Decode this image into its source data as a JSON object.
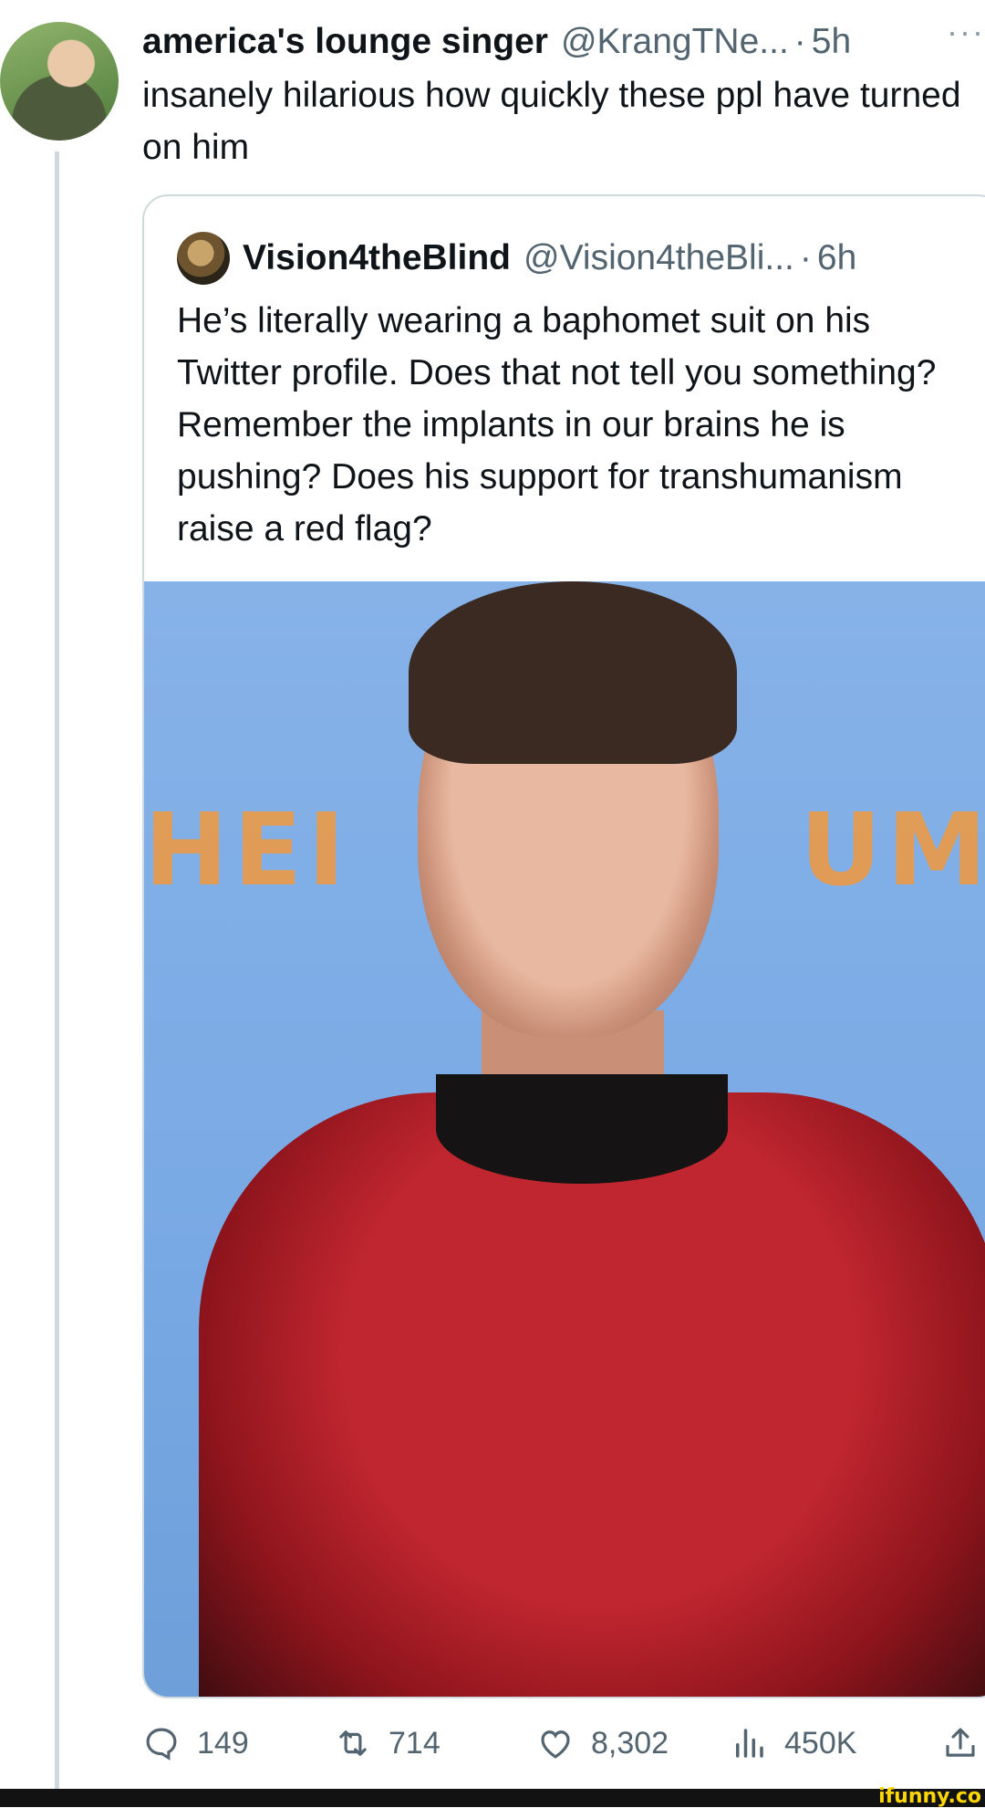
{
  "tweet": {
    "display_name": "america's lounge singer",
    "handle": "@KrangTNe...",
    "separator": "·",
    "time": "5h",
    "more_icon": "···",
    "text": "insanely hilarious how quickly these ppl have turned on him"
  },
  "quote": {
    "display_name": "Vision4theBlind",
    "handle": "@Vision4theBli...",
    "separator": "·",
    "time": "6h",
    "text": "He’s literally wearing a baphomet suit on his Twitter profile. Does that not tell you something? Remember the implants in our brains he is pushing? Does his support for transhumanism raise a red flag?",
    "image_backdrop_left": "HEI",
    "image_backdrop_right": "UM"
  },
  "actions": {
    "reply_count": "149",
    "retweet_count": "714",
    "like_count": "8,302",
    "views_count": "450K"
  },
  "watermark": "ifunny.co",
  "icons": [
    "reply-icon",
    "retweet-icon",
    "heart-icon",
    "views-icon",
    "share-icon",
    "more-icon"
  ],
  "colors": {
    "text_primary": "#0f1419",
    "text_secondary": "#536471",
    "border": "#cfd9de",
    "watermark": "#ffd600"
  }
}
